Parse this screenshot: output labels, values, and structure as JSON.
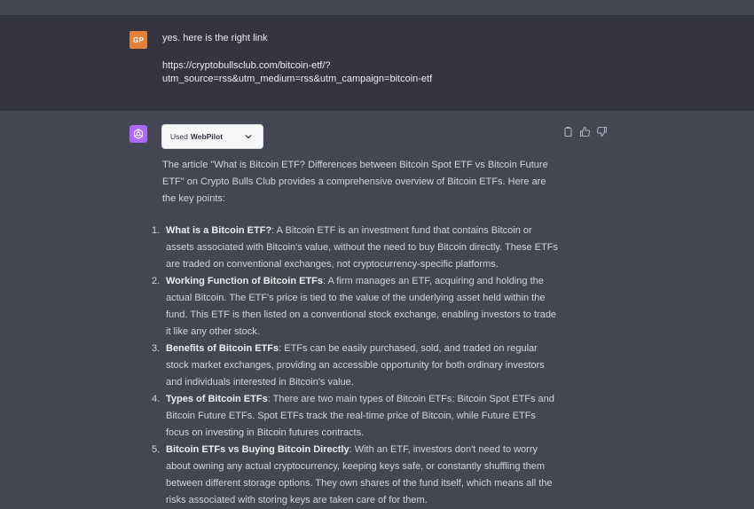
{
  "user_message": {
    "avatar_initials": "GP",
    "avatar_color": "#e3823b",
    "line1": "yes. here is the right link",
    "line2": "https://cryptobullsclub.com/bitcoin-etf/?",
    "line3": "utm_source=rss&utm_medium=rss&utm_campaign=bitcoin-etf"
  },
  "assistant": {
    "avatar_color": "#ab68ff",
    "plugin": {
      "used_label": "Used",
      "plugin_name": "WebPilot",
      "icon": "chevron-down-icon"
    },
    "actions": [
      "copy-icon",
      "thumbs-up-icon",
      "thumbs-down-icon"
    ],
    "intro": "The article \"What is Bitcoin ETF? Differences between Bitcoin Spot ETF vs Bitcoin Future ETF\" on Crypto Bulls Club provides a comprehensive overview of Bitcoin ETFs. Here are the key points:",
    "points": [
      {
        "num": "1.",
        "title": "What is a Bitcoin ETF?",
        "text": ": A Bitcoin ETF is an investment fund that contains Bitcoin or assets associated with Bitcoin's value, without the need to buy Bitcoin directly. These ETFs are traded on conventional exchanges, not cryptocurrency-specific platforms."
      },
      {
        "num": "2.",
        "title": "Working Function of Bitcoin ETFs",
        "text": ": A firm manages an ETF, acquiring and holding the actual Bitcoin. The ETF's price is tied to the value of the underlying asset held within the fund. This ETF is then listed on a conventional stock exchange, enabling investors to trade it like any other stock."
      },
      {
        "num": "3.",
        "title": "Benefits of Bitcoin ETFs",
        "text": ": ETFs can be easily purchased, sold, and traded on regular stock market exchanges, providing an accessible opportunity for both ordinary investors and individuals interested in Bitcoin's value."
      },
      {
        "num": "4.",
        "title": "Types of Bitcoin ETFs",
        "text": ": There are two main types of Bitcoin ETFs: Bitcoin Spot ETFs and Bitcoin Future ETFs. Spot ETFs track the real-time price of Bitcoin, while Future ETFs focus on investing in Bitcoin futures contracts."
      },
      {
        "num": "5.",
        "title": "Bitcoin ETFs vs Buying Bitcoin Directly",
        "text": ": With an ETF, investors don't need to worry about owning any actual cryptocurrency, keeping keys safe, or constantly shuffling them between different storage options. They own shares of the fund itself, which means all the risks associated with storing keys are taken care of for them."
      }
    ]
  }
}
